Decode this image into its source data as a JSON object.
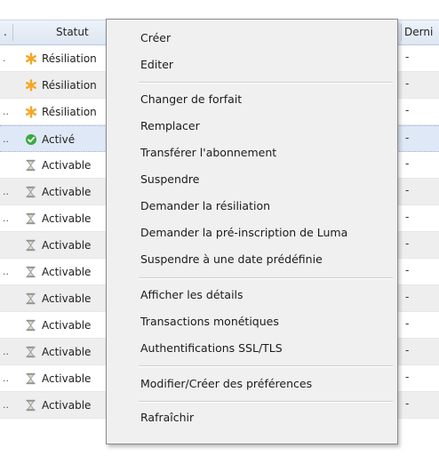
{
  "header": {
    "col_statut": "Statut",
    "col_dernier": "Derni",
    "col_left": "."
  },
  "icons": {
    "asterisk": "#f5a623",
    "check": "#3aa940",
    "hourglass": "#8a93a6"
  },
  "rows": [
    {
      "status": "Résiliation",
      "icon": "asterisk-icon",
      "dot": ".",
      "last": "-"
    },
    {
      "status": "Résiliation",
      "icon": "asterisk-icon",
      "dot": "",
      "last": "-"
    },
    {
      "status": "Résiliation",
      "icon": "asterisk-icon",
      "dot": "..",
      "last": "-"
    },
    {
      "status": "Activé",
      "icon": "check-circle-icon",
      "dot": "..",
      "last": "-"
    },
    {
      "status": "Activable",
      "icon": "hourglass-icon",
      "dot": "",
      "last": "-"
    },
    {
      "status": "Activable",
      "icon": "hourglass-icon",
      "dot": "..",
      "last": "-"
    },
    {
      "status": "Activable",
      "icon": "hourglass-icon",
      "dot": "..",
      "last": "-"
    },
    {
      "status": "Activable",
      "icon": "hourglass-icon",
      "dot": "",
      "last": "-"
    },
    {
      "status": "Activable",
      "icon": "hourglass-icon",
      "dot": "..",
      "last": "-"
    },
    {
      "status": "Activable",
      "icon": "hourglass-icon",
      "dot": "",
      "last": "-"
    },
    {
      "status": "Activable",
      "icon": "hourglass-icon",
      "dot": "",
      "last": "-"
    },
    {
      "status": "Activable",
      "icon": "hourglass-icon",
      "dot": "..",
      "last": "-"
    },
    {
      "status": "Activable",
      "icon": "hourglass-icon",
      "dot": "..",
      "last": "-"
    },
    {
      "status": "Activable",
      "icon": "hourglass-icon",
      "dot": "..",
      "last": "-"
    }
  ],
  "context_menu": {
    "items": [
      "Créer",
      "Editer",
      "Changer de forfait",
      "Remplacer",
      "Transférer l'abonnement",
      "Suspendre",
      "Demander la résiliation",
      "Demander la pré-inscription de Luma",
      "Suspendre à une date prédéfinie",
      "Afficher les détails",
      "Transactions monétiques",
      "Authentifications SSL/TLS",
      "Modifier/Créer des préférences",
      "Rafraîchir"
    ]
  }
}
